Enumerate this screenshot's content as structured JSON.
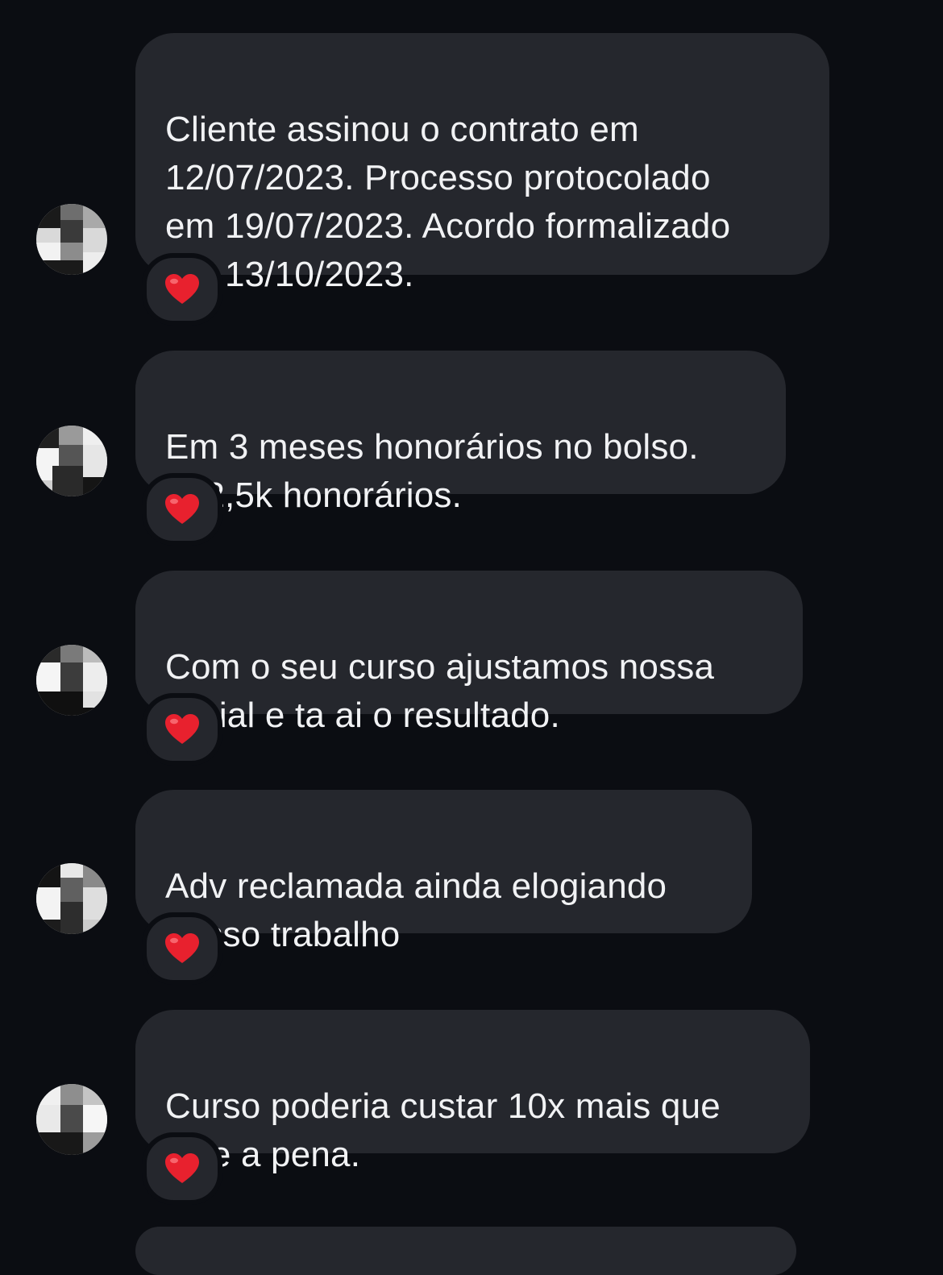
{
  "thread": {
    "background": "#0b0d12",
    "bubble_color": "#25272d",
    "text_color": "#f1f2f4",
    "messages": [
      {
        "text": "Cliente assinou o contrato em\n12/07/2023. Processo protocolado\nem 19/07/2023. Acordo formalizado\nem 13/10/2023.",
        "reaction": "heart-icon"
      },
      {
        "text": "Em 3 meses honorários no bolso.\n122,5k honorários.",
        "reaction": "heart-icon"
      },
      {
        "text": "Com o seu curso ajustamos nossa\ninicial e ta ai o resultado.",
        "reaction": "heart-icon"
      },
      {
        "text": "Adv reclamada ainda elogiando\nnosso trabalho",
        "reaction": "heart-icon"
      },
      {
        "text": "Curso poderia custar 10x mais que\nvale a pena.",
        "reaction": "heart-icon"
      }
    ],
    "avatar": "pixelated-avatar-icon",
    "reaction_color": "#e8212e"
  }
}
